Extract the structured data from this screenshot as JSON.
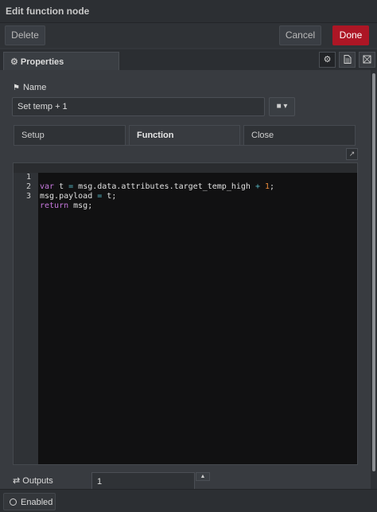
{
  "window": {
    "title": "Edit function node"
  },
  "toolbar": {
    "delete_label": "Delete",
    "cancel_label": "Cancel",
    "done_label": "Done"
  },
  "tabs": {
    "properties_label": "Properties",
    "icons": [
      "gear-icon",
      "description-icon",
      "appearance-icon"
    ]
  },
  "form": {
    "name_label": "Name",
    "name_value": "Set temp + 1",
    "subtabs": [
      {
        "label": "Setup",
        "active": false
      },
      {
        "label": "Function",
        "active": true
      },
      {
        "label": "Close",
        "active": false
      }
    ],
    "outputs_label": "Outputs",
    "outputs_value": "1"
  },
  "editor": {
    "lines": [
      {
        "number": "1",
        "text": "var t = msg.data.attributes.target_temp_high + 1;"
      },
      {
        "number": "2",
        "text": "msg.payload = t;"
      },
      {
        "number": "3",
        "text": "return msg;"
      }
    ]
  },
  "footer": {
    "enabled_label": "Enabled"
  },
  "colors": {
    "done": "#ad1625",
    "keyword": "#c678dd",
    "operator": "#56b6c2",
    "number": "#e88a3a"
  }
}
